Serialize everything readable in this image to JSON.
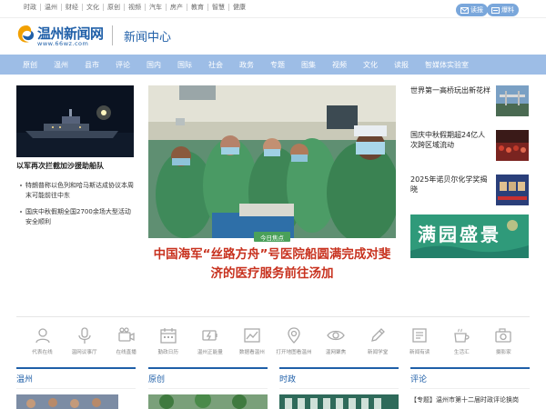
{
  "topnav": {
    "items": [
      "时政",
      "温州",
      "财经",
      "文化",
      "原创",
      "视频",
      "汽车",
      "房产",
      "教育",
      "智慧",
      "健康"
    ]
  },
  "top_buttons": [
    {
      "icon": "mail-icon",
      "label": "读报"
    },
    {
      "icon": "book-icon",
      "label": "爆料"
    }
  ],
  "logo": {
    "text": "温州新闻网",
    "url": "www.66wz.com"
  },
  "section_title": "新闻中心",
  "mainnav": {
    "items": [
      "原创",
      "温州",
      "县市",
      "评论",
      "国内",
      "国际",
      "社会",
      "政务",
      "专题",
      "图集",
      "视频",
      "文化",
      "读报",
      "智媒体实验室"
    ]
  },
  "left": {
    "headline": "以军再次拦截加沙援助船队",
    "items": [
      "特朗普称以色列和哈马斯达成协议本周末可能前往中东",
      "国庆中秋假期全国2700余场大型活动安全顺利"
    ]
  },
  "hero": {
    "tag": "今日焦点",
    "title": "中国海军“丝路方舟”号医院船圆满完成对斐济的医疗服务前往汤加"
  },
  "right": {
    "items": [
      "世界第一高桥玩出新花样",
      "国庆中秋假期超24亿人次跨区域流动",
      "2025年诺贝尔化学奖揭晓"
    ],
    "banner_text": "满园盛景"
  },
  "icons": [
    {
      "icon": "user-icon",
      "label": "代表在线"
    },
    {
      "icon": "microphone-icon",
      "label": "温网议事厅"
    },
    {
      "icon": "video-camera-icon",
      "label": "在线直播"
    },
    {
      "icon": "calendar-icon",
      "label": "勤政日历"
    },
    {
      "icon": "lightning-icon",
      "label": "温州正能量"
    },
    {
      "icon": "chart-icon",
      "label": "数据看温州"
    },
    {
      "icon": "map-pin-icon",
      "label": "打开地图看温州"
    },
    {
      "icon": "eye-icon",
      "label": "温网聚焦"
    },
    {
      "icon": "pencil-icon",
      "label": "新闻学堂"
    },
    {
      "icon": "newspaper-icon",
      "label": "新闻有读"
    },
    {
      "icon": "cup-icon",
      "label": "生活汇"
    },
    {
      "icon": "camera-icon",
      "label": "摄影家"
    }
  ],
  "bottom": {
    "columns": [
      "温州",
      "原创",
      "时政",
      "评论"
    ],
    "pinglun_item": "【专题】温州市第十二届时政评论换岗"
  },
  "colors": {
    "brand": "#1f5fa8",
    "nav_bg": "#9dbde6",
    "headline": "#c8321f",
    "tag_green": "#4aa05a"
  }
}
